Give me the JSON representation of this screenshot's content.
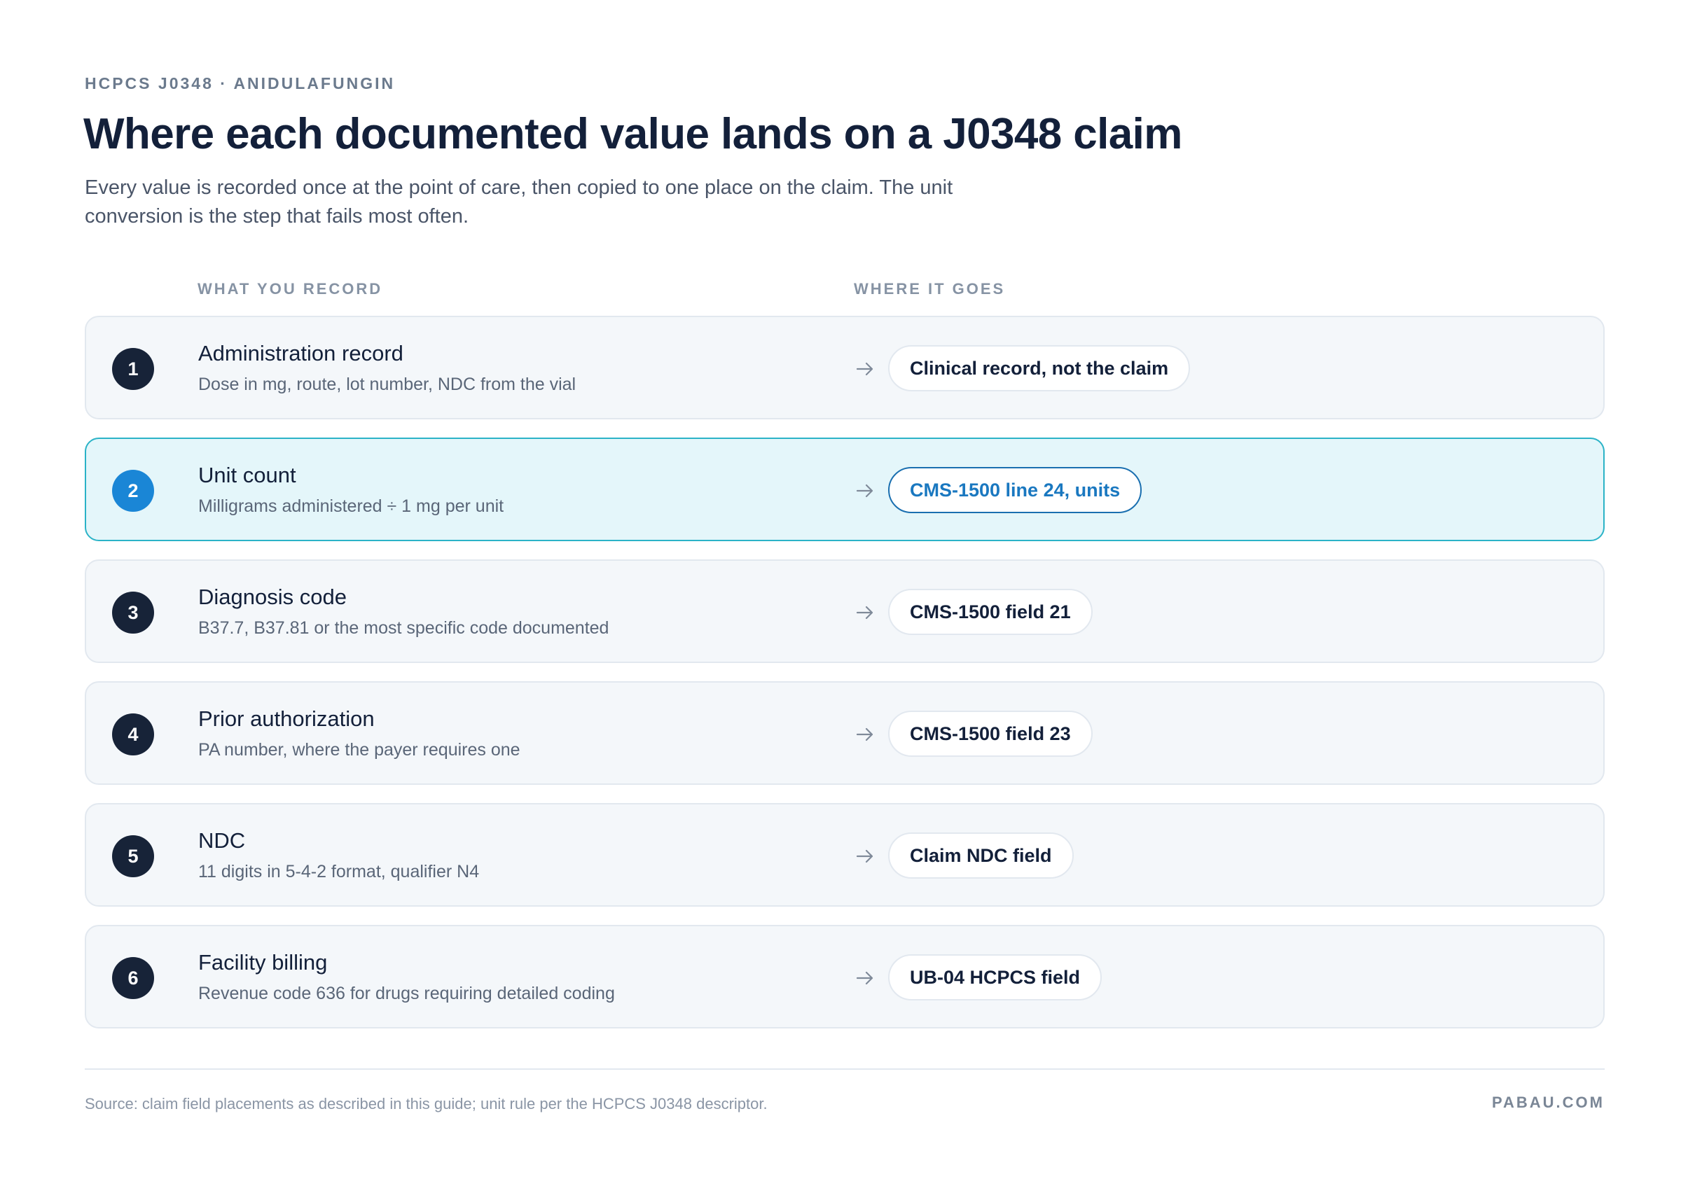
{
  "header": {
    "eyebrow": "HCPCS J0348 · ANIDULAFUNGIN",
    "title": "Where each documented value lands on a J0348 claim",
    "subtitle": "Every value is recorded once at the point of care, then copied to one place on the claim. The unit conversion is the step that fails most often."
  },
  "columns": {
    "left": "WHAT YOU RECORD",
    "right": "WHERE IT GOES"
  },
  "rows": [
    {
      "number": "1",
      "label": "Administration record",
      "description": "Dose in mg, route, lot number, NDC from the vial",
      "destination": "Clinical record, not the claim",
      "highlight": false
    },
    {
      "number": "2",
      "label": "Unit count",
      "description": "Milligrams administered ÷ 1 mg per unit",
      "destination": "CMS-1500 line 24, units",
      "highlight": true
    },
    {
      "number": "3",
      "label": "Diagnosis code",
      "description": "B37.7, B37.81 or the most specific code documented",
      "destination": "CMS-1500 field 21",
      "highlight": false
    },
    {
      "number": "4",
      "label": "Prior authorization",
      "description": "PA number, where the payer requires one",
      "destination": "CMS-1500 field 23",
      "highlight": false
    },
    {
      "number": "5",
      "label": "NDC",
      "description": "11 digits in 5-4-2 format, qualifier N4",
      "destination": "Claim NDC field",
      "highlight": false
    },
    {
      "number": "6",
      "label": "Facility billing",
      "description": "Revenue code 636 for drugs requiring detailed coding",
      "destination": "UB-04 HCPCS field",
      "highlight": false
    }
  ],
  "footer": {
    "source": "Source: claim field placements as described in this guide; unit rule per the HCPCS J0348 descriptor.",
    "brand": "PABAU.COM"
  },
  "colors": {
    "badge_dark": "#172338",
    "badge_accent": "#1a86d6",
    "highlight_bg": "#e4f6fa",
    "highlight_border": "#2bb3c7",
    "row_bg": "#f4f7fa"
  },
  "icons": {
    "arrow": "arrow-right-icon"
  }
}
